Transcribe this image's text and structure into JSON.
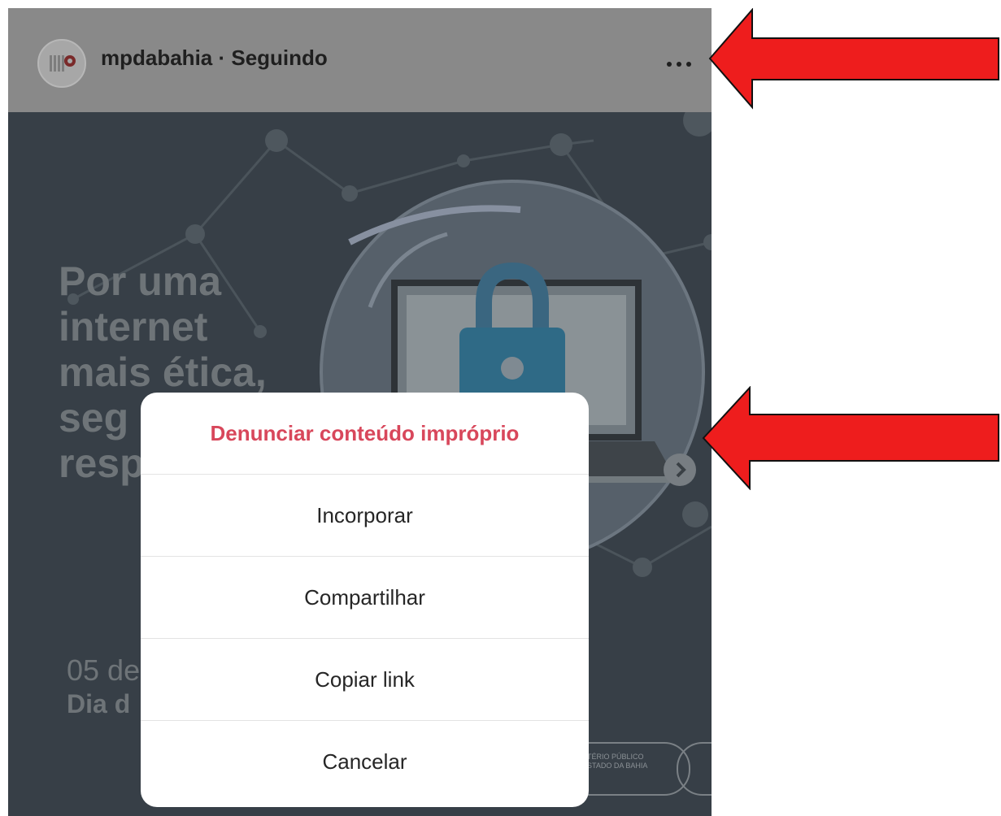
{
  "header": {
    "username": "mpdabahia",
    "separator": " · ",
    "follow_status": "Seguindo",
    "more_icon": "more-horizontal-icon"
  },
  "post": {
    "headline_lines": [
      "Por uma",
      "internet",
      "mais ética,",
      "seg",
      "resp"
    ],
    "date_line": "05 de",
    "day_line": "Dia d",
    "logo_lines": [
      "TÉRIO PÚBLICO",
      "STADO DA BAHIA"
    ],
    "next_icon": "chevron-right-icon",
    "illustration_icon": "padlock-icon"
  },
  "options_menu": {
    "items": [
      {
        "label": "Denunciar conteúdo impróprio",
        "style": "danger"
      },
      {
        "label": "Incorporar",
        "style": "normal"
      },
      {
        "label": "Compartilhar",
        "style": "normal"
      },
      {
        "label": "Copiar link",
        "style": "normal"
      },
      {
        "label": "Cancelar",
        "style": "normal"
      }
    ]
  },
  "annotations": {
    "arrow_color": "#ee1d1d",
    "arrow_icons": [
      "arrow-left-icon",
      "arrow-left-icon"
    ]
  },
  "colors": {
    "danger": "#d8475b",
    "overlay_header": "#898989",
    "post_background": "#373f47"
  }
}
